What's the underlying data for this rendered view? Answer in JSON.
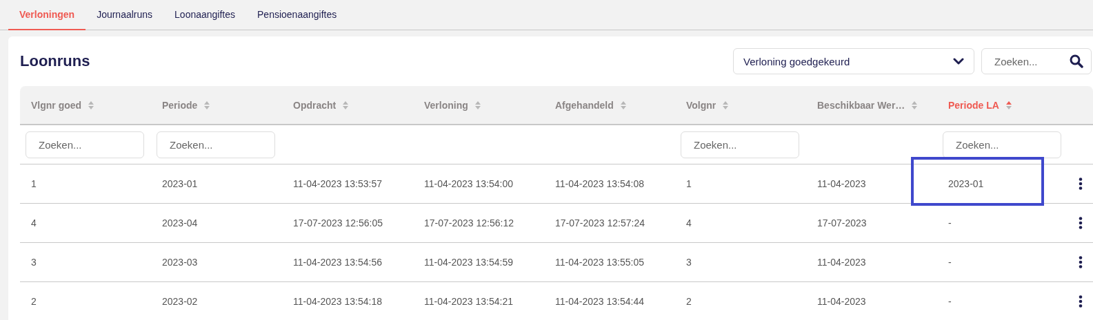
{
  "tabs": [
    {
      "label": "Verloningen",
      "selected": true
    },
    {
      "label": "Journaalruns",
      "selected": false
    },
    {
      "label": "Loonaangiftes",
      "selected": false
    },
    {
      "label": "Pensioenaangiftes",
      "selected": false
    }
  ],
  "title": "Loonruns",
  "status_filter": {
    "value": "Verloning goedgekeurd"
  },
  "search": {
    "placeholder": "Zoeken..."
  },
  "table": {
    "columns": [
      {
        "label": "Vlgnr goed",
        "sorted": false,
        "filter": {
          "placeholder": "Zoeken..."
        }
      },
      {
        "label": "Periode",
        "sorted": false,
        "filter": {
          "placeholder": "Zoeken..."
        }
      },
      {
        "label": "Opdracht",
        "sorted": false
      },
      {
        "label": "Verloning",
        "sorted": false
      },
      {
        "label": "Afgehandeld",
        "sorted": false
      },
      {
        "label": "Volgnr",
        "sorted": false,
        "filter": {
          "placeholder": "Zoeken..."
        }
      },
      {
        "label": "Beschikbaar Wer…",
        "sorted": false
      },
      {
        "label": "Periode LA",
        "sorted": true,
        "filter": {
          "placeholder": "Zoeken..."
        }
      }
    ],
    "rows": [
      {
        "cells": [
          {
            "text": "1",
            "highlighted": false
          },
          {
            "text": "2023-01",
            "highlighted": false
          },
          {
            "text": "11-04-2023 13:53:57",
            "highlighted": false
          },
          {
            "text": "11-04-2023 13:54:00",
            "highlighted": false
          },
          {
            "text": "11-04-2023 13:54:08",
            "highlighted": false
          },
          {
            "text": "1",
            "highlighted": false
          },
          {
            "text": "11-04-2023",
            "highlighted": false
          },
          {
            "text": "2023-01",
            "highlighted": true
          }
        ]
      },
      {
        "cells": [
          {
            "text": "4",
            "highlighted": false
          },
          {
            "text": "2023-04",
            "highlighted": false
          },
          {
            "text": "17-07-2023 12:56:05",
            "highlighted": false
          },
          {
            "text": "17-07-2023 12:56:12",
            "highlighted": false
          },
          {
            "text": "17-07-2023 12:57:24",
            "highlighted": false
          },
          {
            "text": "4",
            "highlighted": false
          },
          {
            "text": "17-07-2023",
            "highlighted": false
          },
          {
            "text": "-",
            "highlighted": false
          }
        ]
      },
      {
        "cells": [
          {
            "text": "3",
            "highlighted": false
          },
          {
            "text": "2023-03",
            "highlighted": false
          },
          {
            "text": "11-04-2023 13:54:56",
            "highlighted": false
          },
          {
            "text": "11-04-2023 13:54:59",
            "highlighted": false
          },
          {
            "text": "11-04-2023 13:55:05",
            "highlighted": false
          },
          {
            "text": "3",
            "highlighted": false
          },
          {
            "text": "11-04-2023",
            "highlighted": false
          },
          {
            "text": "-",
            "highlighted": false
          }
        ]
      },
      {
        "cells": [
          {
            "text": "2",
            "highlighted": false
          },
          {
            "text": "2023-02",
            "highlighted": false
          },
          {
            "text": "11-04-2023 13:54:18",
            "highlighted": false
          },
          {
            "text": "11-04-2023 13:54:21",
            "highlighted": false
          },
          {
            "text": "11-04-2023 13:54:44",
            "highlighted": false
          },
          {
            "text": "2",
            "highlighted": false
          },
          {
            "text": "11-04-2023",
            "highlighted": false
          },
          {
            "text": "-",
            "highlighted": false
          }
        ]
      }
    ]
  }
}
